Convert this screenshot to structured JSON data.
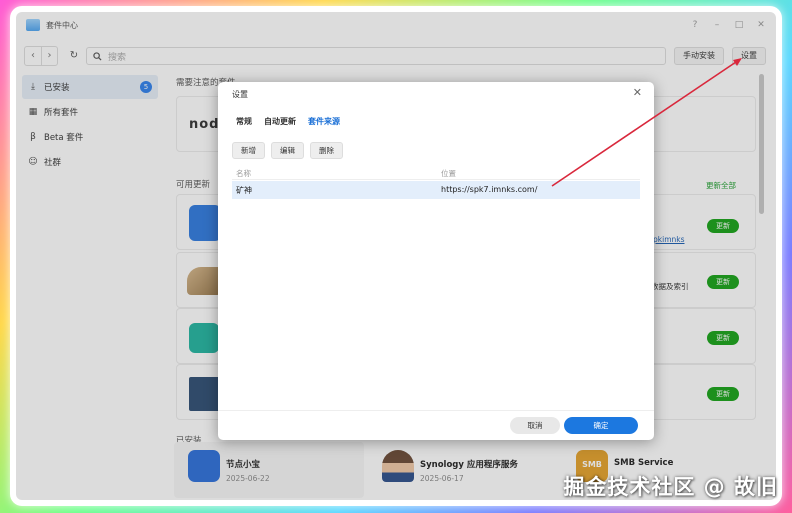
{
  "window": {
    "title": "套件中心",
    "controls": [
      "?",
      "–",
      "□",
      "✕"
    ]
  },
  "toolbar": {
    "search_placeholder": "搜索",
    "manual_install_label": "手动安装",
    "settings_label": "设置"
  },
  "sidebar": {
    "items": [
      {
        "label": "已安装",
        "badge": "5",
        "icon": "download-icon"
      },
      {
        "label": "所有套件",
        "icon": "grid-icon"
      },
      {
        "label": "Beta 套件",
        "icon": "beta-icon"
      },
      {
        "label": "社群",
        "icon": "community-icon"
      }
    ]
  },
  "main": {
    "notice_section_label": "需要注意的套件",
    "node_logo_text": "node",
    "updates_section_label": "可用更新",
    "update_all_label": "更新全部",
    "update_button_label": "更新",
    "update_side_texts": [
      "pkimnks",
      "数据及索引"
    ],
    "installed_section_label": "已安装",
    "installed": [
      {
        "name": "节点小宝",
        "date": "2025-06-22"
      },
      {
        "name": "Synology 应用程序服务",
        "date": "2025-06-17"
      },
      {
        "name": "SMB Service",
        "date": ""
      }
    ],
    "smb_tile_text": "SMB"
  },
  "dialog": {
    "title": "设置",
    "tabs": [
      "常规",
      "自动更新",
      "套件来源"
    ],
    "active_tab": 2,
    "buttons": [
      "新增",
      "编辑",
      "删除"
    ],
    "columns": [
      "名称",
      "位置"
    ],
    "rows": [
      {
        "name": "矿神",
        "location": "https://spk7.imnks.com/"
      }
    ],
    "cancel_label": "取消",
    "ok_label": "确定"
  },
  "watermark": "掘金技术社区 @ 故旧",
  "colors": {
    "accent": "#1c78e0",
    "update_green": "#17a317",
    "annotation_arrow": "#d9283c"
  }
}
